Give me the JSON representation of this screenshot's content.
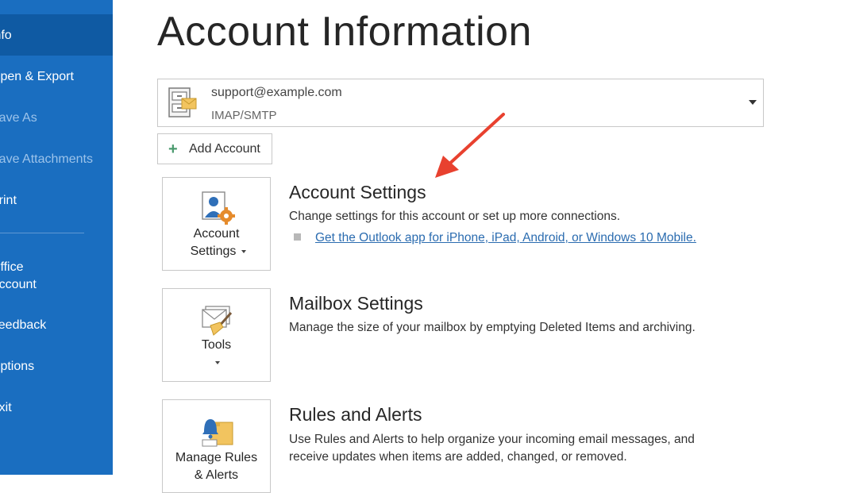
{
  "sidebar": {
    "items": [
      {
        "label": "Info"
      },
      {
        "label": "Open & Export"
      },
      {
        "label": "Save As"
      },
      {
        "label": "Save Attachments"
      },
      {
        "label": "Print"
      },
      {
        "label": "Office\nAccount"
      },
      {
        "label": "Feedback"
      },
      {
        "label": "Options"
      },
      {
        "label": "Exit"
      }
    ],
    "bg_color": "#1a6ec0",
    "active_color": "#0f5aa3"
  },
  "page": {
    "title": "Account Information"
  },
  "account": {
    "email": "support@example.com",
    "type": "IMAP/SMTP",
    "icon": "account-card-icon"
  },
  "add_account": {
    "label": "Add Account",
    "icon": "plus-icon"
  },
  "sections": [
    {
      "tile_label_line1": "Account",
      "tile_label_line2": "Settings",
      "tile_icon": "account-settings-gear-icon",
      "title": "Account Settings",
      "description": "Change settings for this account or set up more connections.",
      "link": "Get the Outlook app for iPhone, iPad, Android, or Windows 10 Mobile."
    },
    {
      "tile_label_line1": "Tools",
      "tile_icon": "tools-broom-icon",
      "title": "Mailbox Settings",
      "description": "Manage the size of your mailbox by emptying Deleted Items and archiving."
    },
    {
      "tile_label_line1": "Manage Rules",
      "tile_label_line2": "& Alerts",
      "tile_icon": "rules-alerts-bell-icon",
      "title": "Rules and Alerts",
      "description_line1": "Use Rules and Alerts to help organize your incoming email messages, and",
      "description_line2": "receive updates when items are added, changed, or removed."
    }
  ],
  "annotation": {
    "arrow_color": "#e8412f",
    "icon": "red-arrow-icon"
  }
}
